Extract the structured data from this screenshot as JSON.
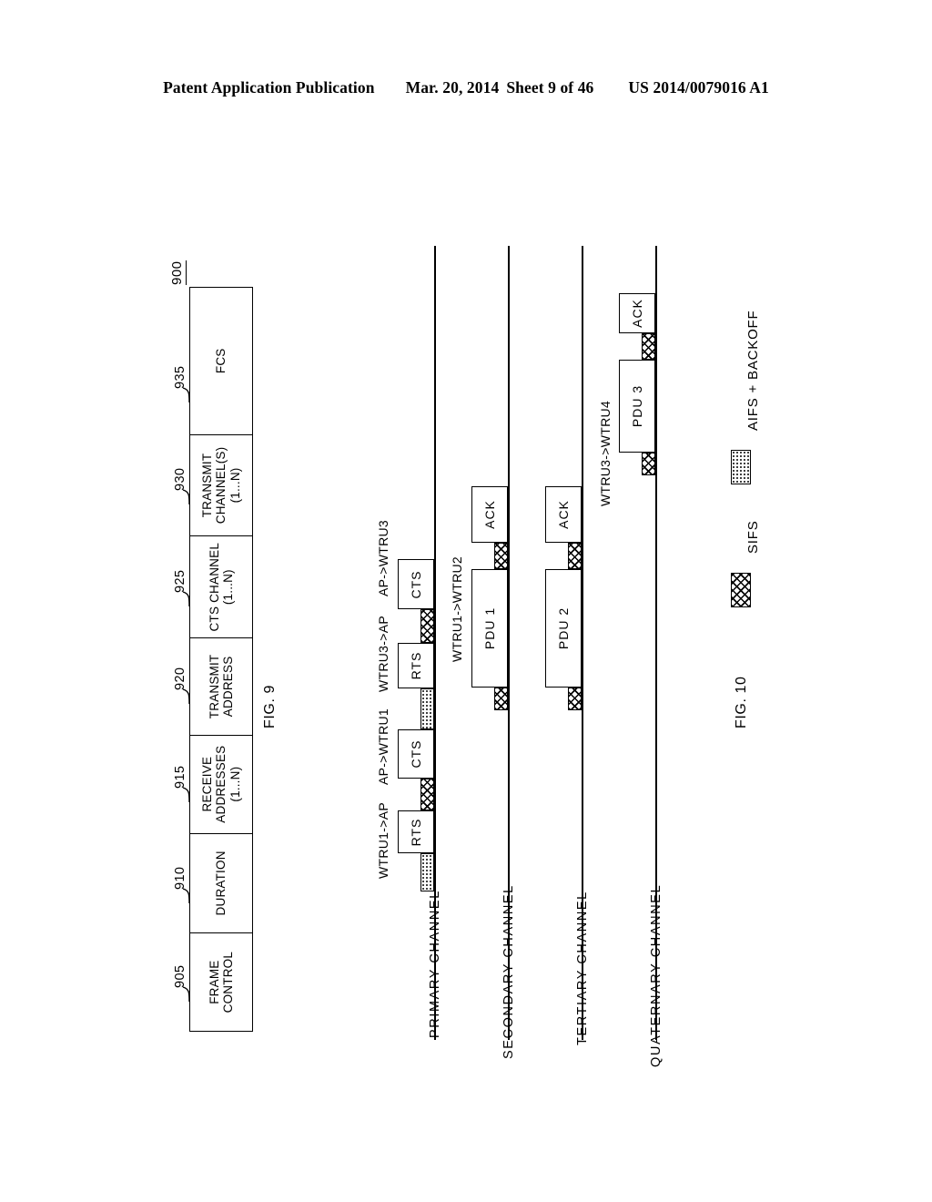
{
  "header": {
    "left": "Patent Application Publication",
    "date": "Mar. 20, 2014",
    "sheet": "Sheet 9 of 46",
    "docnum": "US 2014/0079016 A1"
  },
  "fig9": {
    "caption": "FIG. 9",
    "ref": "900",
    "fields": [
      {
        "num": "905",
        "lines": [
          "FRAME",
          "CONTROL"
        ]
      },
      {
        "num": "910",
        "lines": [
          "DURATION"
        ]
      },
      {
        "num": "915",
        "lines": [
          "RECEIVE",
          "ADDRESSES",
          "(1...N)"
        ]
      },
      {
        "num": "920",
        "lines": [
          "TRANSMIT",
          "ADDRESS"
        ]
      },
      {
        "num": "925",
        "lines": [
          "CTS  CHANNEL",
          "(1...N)"
        ]
      },
      {
        "num": "930",
        "lines": [
          "TRANSMIT",
          "CHANNEL(S)",
          "(1...N)"
        ]
      },
      {
        "num": "935",
        "lines": [
          "FCS"
        ]
      }
    ]
  },
  "fig10": {
    "caption": "FIG. 10",
    "channels": [
      {
        "label": "PRIMARY CHANNEL",
        "flow_labels": [
          "WTRU1->AP",
          "AP->WTRU1",
          "WTRU3->AP",
          "AP->WTRU3"
        ],
        "blocks": [
          "AIFS + BACKOFF",
          "RTS",
          "SIFS",
          "CTS",
          "AIFS + BACKOFF",
          "RTS",
          "SIFS",
          "CTS"
        ],
        "named_blocks": [
          "RTS",
          "CTS",
          "RTS",
          "CTS"
        ]
      },
      {
        "label": "SECONDARY CHANNEL",
        "flow_labels": [
          "WTRU1->WTRU2"
        ],
        "blocks": [
          "SIFS",
          "PDU 1",
          "SIFS",
          "ACK"
        ],
        "named_blocks": [
          "PDU 1",
          "ACK"
        ]
      },
      {
        "label": "TERTIARY CHANNEL",
        "flow_labels": [],
        "blocks": [
          "SIFS",
          "PDU 2",
          "SIFS",
          "ACK"
        ],
        "named_blocks": [
          "PDU 2",
          "ACK"
        ]
      },
      {
        "label": "QUATERNARY CHANNEL",
        "flow_labels": [
          "WTRU3->WTRU4"
        ],
        "blocks": [
          "SIFS",
          "PDU 3",
          "SIFS",
          "ACK"
        ],
        "named_blocks": [
          "PDU 3",
          "ACK"
        ]
      }
    ],
    "legend": [
      {
        "swatch": "crosshatch",
        "label": "SIFS"
      },
      {
        "swatch": "dotted",
        "label": "AIFS + BACKOFF"
      }
    ]
  }
}
